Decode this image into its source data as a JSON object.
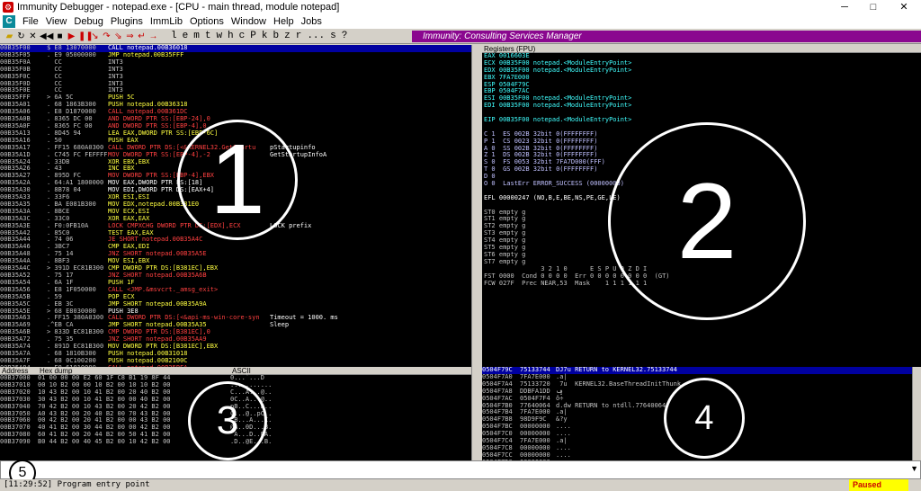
{
  "window": {
    "title": "Immunity Debugger - notepad.exe - [CPU - main thread, module notepad]",
    "minimize": "─",
    "maximize": "□",
    "close": "✕"
  },
  "menu": [
    "File",
    "View",
    "Debug",
    "Plugins",
    "ImmLib",
    "Options",
    "Window",
    "Help",
    "Jobs"
  ],
  "toolbar": {
    "letters": [
      "l",
      "e",
      "m",
      "t",
      "w",
      "h",
      "c",
      "P",
      "k",
      "b",
      "z",
      "r",
      "...",
      "s",
      "?"
    ],
    "consulting": "Immunity: Consulting Services Manager"
  },
  "cpu": {
    "rows": [
      {
        "a": "00B35F00",
        "h": "$ E8 13070000",
        "i": "CALL notepad.00B36018",
        "c": "c-red",
        "sel": true
      },
      {
        "a": "00B35F05",
        "h": ". E9 05000000",
        "i": "JMP notepad.00B35FFF",
        "c": "c-yellow"
      },
      {
        "a": "00B35F0A",
        "h": "  CC",
        "i": "INT3",
        "c": ""
      },
      {
        "a": "00B35F0B",
        "h": "  CC",
        "i": "INT3",
        "c": ""
      },
      {
        "a": "00B35F0C",
        "h": "  CC",
        "i": "INT3",
        "c": ""
      },
      {
        "a": "00B35F0D",
        "h": "  CC",
        "i": "INT3",
        "c": ""
      },
      {
        "a": "00B35F0E",
        "h": "  CC",
        "i": "INT3",
        "c": ""
      },
      {
        "a": "00B35FFF",
        "h": "> 6A 5C",
        "i": "PUSH 5C",
        "c": "c-yellow"
      },
      {
        "a": "00B35A01",
        "h": ". 68 1863B300",
        "i": "PUSH notepad.00B36318",
        "c": "c-yellow"
      },
      {
        "a": "00B35A06",
        "h": ". E8 D1870000",
        "i": "CALL notepad.00B361DC",
        "c": "c-red"
      },
      {
        "a": "00B35A0B",
        "h": ". 8365 DC 00",
        "i": "AND DWORD PTR SS:[EBP-24],0",
        "c": "c-red"
      },
      {
        "a": "00B35A0F",
        "h": ". 8365 FC 00",
        "i": "AND DWORD PTR SS:[EBP-4],0",
        "c": "c-red"
      },
      {
        "a": "00B35A13",
        "h": ". 8D45 94",
        "i": "LEA EAX,DWORD PTR SS:[EBP-6C]",
        "c": "c-yellow"
      },
      {
        "a": "00B35A16",
        "h": ". 50",
        "i": "PUSH EAX",
        "c": "c-yellow"
      },
      {
        "a": "00B35A17",
        "h": ". FF15 680A0300",
        "i": "CALL DWORD PTR DS:[<&KERNEL32.GetStartu",
        "c": "c-red"
      },
      {
        "a": "00B35A1D",
        "h": ". C745 FC FEFFFF",
        "i": "MOV DWORD PTR SS:[EBP-4],-2",
        "c": "c-red"
      },
      {
        "a": "00B35A24",
        "h": ". 33DB",
        "i": "XOR EBX,EBX",
        "c": "c-yellow"
      },
      {
        "a": "00B35A26",
        "h": ". 43",
        "i": "INC EBX",
        "c": "c-yellow"
      },
      {
        "a": "00B35A27",
        "h": ". 895D FC",
        "i": "MOV DWORD PTR SS:[EBP-4],EBX",
        "c": "c-red"
      },
      {
        "a": "00B35A2A",
        "h": ". 64:A1 1800000",
        "i": "MOV EAX,DWORD PTR FS:[18]",
        "c": "c-white"
      },
      {
        "a": "00B35A30",
        "h": ". 8B78 04",
        "i": "MOV EDI,DWORD PTR DS:[EAX+4]",
        "c": "c-white"
      },
      {
        "a": "00B35A33",
        "h": ". 33F6",
        "i": "XOR ESI,ESI",
        "c": "c-yellow"
      },
      {
        "a": "00B35A35",
        "h": ". BA E081B300",
        "i": "MOV EDX,notepad.00B381E0",
        "c": "c-yellow"
      },
      {
        "a": "00B35A3A",
        "h": ". 8BCE",
        "i": "MOV ECX,ESI",
        "c": "c-yellow"
      },
      {
        "a": "00B35A3C",
        "h": ". 33C0",
        "i": "XOR EAX,EAX",
        "c": "c-yellow"
      },
      {
        "a": "00B35A3E",
        "h": ". F0:0FB10A",
        "i": "LOCK CMPXCHG DWORD PTR DS:[EDX],ECX",
        "c": "c-red"
      },
      {
        "a": "00B35A42",
        "h": ". 85C0",
        "i": "TEST EAX,EAX",
        "c": "c-yellow"
      },
      {
        "a": "00B35A44",
        "h": ". 74 06",
        "i": "JE SHORT notepad.00B35A4C",
        "c": "c-red"
      },
      {
        "a": "00B35A46",
        "h": ". 3BC7",
        "i": "CMP EAX,EDI",
        "c": "c-yellow"
      },
      {
        "a": "00B35A48",
        "h": ". 75 14",
        "i": "JNZ SHORT notepad.00B35A5E",
        "c": "c-red"
      },
      {
        "a": "00B35A4A",
        "h": ". 8BF3",
        "i": "MOV ESI,EBX",
        "c": "c-yellow"
      },
      {
        "a": "00B35A4C",
        "h": "> 391D EC81B300",
        "i": "CMP DWORD PTR DS:[B381EC],EBX",
        "c": "c-yellow"
      },
      {
        "a": "00B35A52",
        "h": ". 75 17",
        "i": "JNZ SHORT notepad.00B35A6B",
        "c": "c-red"
      },
      {
        "a": "00B35A54",
        "h": ". 6A 1F",
        "i": "PUSH 1F",
        "c": "c-yellow"
      },
      {
        "a": "00B35A56",
        "h": ". E8 1F050000",
        "i": "CALL <JMP.&msvcrt._amsg_exit>",
        "c": "c-red"
      },
      {
        "a": "00B35A5B",
        "h": ". 59",
        "i": "POP ECX",
        "c": "c-yellow"
      },
      {
        "a": "00B35A5C",
        "h": ". EB 3C",
        "i": "JMP SHORT notepad.00B35A9A",
        "c": "c-yellow"
      },
      {
        "a": "00B35A5E",
        "h": "> 68 E8030000",
        "i": "PUSH 3E8",
        "c": "c-white"
      },
      {
        "a": "00B35A63",
        "h": ". FF15 380A0300",
        "i": "CALL DWORD PTR DS:[<&api-ms-win-core-syn",
        "c": "c-red"
      },
      {
        "a": "00B35A69",
        "h": ".^EB CA",
        "i": "JMP SHORT notepad.00B35A35",
        "c": "c-yellow"
      },
      {
        "a": "00B35A6B",
        "h": "> 833D EC81B300",
        "i": "CMP DWORD PTR DS:[B381EC],0",
        "c": "c-red"
      },
      {
        "a": "00B35A72",
        "h": ". 75 35",
        "i": "JNZ SHORT notepad.00B35AA9",
        "c": "c-red"
      },
      {
        "a": "00B35A74",
        "h": ". 891D EC81B300",
        "i": "MOV DWORD PTR DS:[B381EC],EBX",
        "c": "c-yellow"
      },
      {
        "a": "00B35A7A",
        "h": ". 68 1810B300",
        "i": "PUSH notepad.00B31018",
        "c": "c-yellow"
      },
      {
        "a": "00B35A7F",
        "h": ". 68 0C100200",
        "i": "PUSH notepad.00B2100C",
        "c": "c-yellow"
      },
      {
        "a": "00B35A84",
        "h": ". E8 61010000",
        "i": "CALL notepad.00B35BEA",
        "c": "c-red"
      },
      {
        "a": "00B35A89",
        "h": ". 59",
        "i": "POP ECX",
        "c": "c-yellow"
      },
      {
        "a": "00B35A8A",
        "h": ". 59",
        "i": "POP ECX",
        "c": "c-yellow"
      },
      {
        "a": "00B35A8B",
        "h": ". 85C0",
        "i": "TEST EAX,EAX",
        "c": "c-yellow"
      },
      {
        "a": "00B35A8D",
        "h": ". 74 08",
        "i": "JE SHORT notepad.00B35A9A",
        "c": "c-red"
      },
      {
        "a": "00B35A8F",
        "h": ". E9 3F010000",
        "i": "JMP notepad.00B35BD3",
        "c": "c-yellow"
      },
      {
        "a": "00B35A94",
        "h": ". 891D 8477B300",
        "i": "MOV DWORD PTR DS:[B37784],EBX",
        "c": "c-yellow"
      }
    ],
    "comments": [
      {
        "t": "pStartupinfo",
        "r": 14
      },
      {
        "t": "GetStartupInfoA",
        "r": 15
      },
      {
        "t": "LOCK prefix",
        "r": 25
      },
      {
        "t": "Timeout = 1000. ms",
        "r": 38
      },
      {
        "t": "Sleep",
        "r": 39
      }
    ]
  },
  "registers": {
    "header": "Registers (FPU)",
    "lines": [
      "EAX 0016603E",
      "ECX 00B35F00 notepad.<ModuleEntryPoint>",
      "EDX 00B35F00 notepad.<ModuleEntryPoint>",
      "EBX 7FA7E000",
      "ESP 0504F79C",
      "EBP 0504F7AC",
      "ESI 00B35F00 notepad.<ModuleEntryPoint>",
      "EDI 00B35F00 notepad.<ModuleEntryPoint>",
      "",
      "EIP 00B35F00 notepad.<ModuleEntryPoint>",
      "",
      "C 1  ES 002B 32bit 0(FFFFFFFF)",
      "P 1  CS 0023 32bit 0(FFFFFFFF)",
      "A 0  SS 002B 32bit 0(FFFFFFFF)",
      "Z 1  DS 002B 32bit 0(FFFFFFFF)",
      "S 0  FS 0053 32bit 7FA7D000(FFF)",
      "T 0  GS 002B 32bit 0(FFFFFFFF)",
      "D 0",
      "O 0  LastErr ERROR_SUCCESS (00000000)",
      "",
      "EFL 00000247 (NO,B,E,BE,NS,PE,GE,LE)",
      "",
      "ST0 empty g",
      "ST1 empty g",
      "ST2 empty g",
      "ST3 empty g",
      "ST4 empty g",
      "ST5 empty g",
      "ST6 empty g",
      "ST7 empty g",
      "               3 2 1 0      E S P U O Z D I",
      "FST 0000  Cond 0 0 0 0  Err 0 0 0 0 0 0 0 0  (GT)",
      "FCW 027F  Prec NEAR,53  Mask    1 1 1 1 1 1"
    ]
  },
  "dump": {
    "headers": [
      "Address",
      "Hex dump",
      "ASCII"
    ],
    "rows": [
      [
        "00B37000",
        "01 00 00 00 E2 60 1F C8 B1 19 8F 44",
        "0...`...D"
      ],
      [
        "00B37010",
        "00 10 B2 00 00 10 B2 00 10 10 B2 00",
        "..........."
      ],
      [
        "00B37020",
        "10 43 B2 00 10 41 B2 00 20 40 B2 00",
        "C...A...@.."
      ],
      [
        "00B37030",
        "30 43 B2 00 10 41 B2 00 00 40 B2 00",
        "0C..A...@.."
      ],
      [
        "00B37040",
        "70 42 B2 00 10 43 B2 00 20 42 B2 00",
        "pB..C...B.."
      ],
      [
        "00B37050",
        "A0 43 B2 00 20 40 B2 00 70 43 B2 00",
        "C...@..pC.."
      ],
      [
        "00B37060",
        "00 42 B2 00 20 41 B2 00 00 43 B2 00",
        ".B...A...C."
      ],
      [
        "00B37070",
        "40 41 B2 00 30 44 B2 00 00 42 B2 00",
        "@A..0D...B."
      ],
      [
        "00B37080",
        "60 41 B2 00 20 44 B2 00 50 41 B2 00",
        "`A...D..PA."
      ],
      [
        "00B37090",
        "B0 44 B2 00 40 45 B2 00 10 42 B2 00",
        ".D..@E...B."
      ]
    ]
  },
  "stack": {
    "rows": [
      {
        "a": "0504F79C",
        "v": "75133744",
        "c": "DJ7u RETURN to KERNEL32.75133744",
        "sel": true
      },
      {
        "a": "0504F7A0",
        "v": "7FA7E000",
        "c": ".a|"
      },
      {
        "a": "0504F7A4",
        "v": "75133720",
        "c": " 7u  KERNEL32.BaseThreadInitThunk"
      },
      {
        "a": "0504F7A8",
        "v": "DDBFA1DD",
        "c": "ݡ"
      },
      {
        "a": "0504F7AC",
        "v": "0504F7F4",
        "c": "ô÷"
      },
      {
        "a": "0504F7B0",
        "v": "77640064",
        "c": "d.dw RETURN to ntdll.77640064"
      },
      {
        "a": "0504F7B4",
        "v": "7FA7E000",
        "c": ".a|"
      },
      {
        "a": "0504F7B8",
        "v": "98D9F9C",
        "c": "&?y"
      },
      {
        "a": "0504F7BC",
        "v": "00000000",
        "c": "...."
      },
      {
        "a": "0504F7C0",
        "v": "00000000",
        "c": "...."
      },
      {
        "a": "0504F7C4",
        "v": "7FA7E000",
        "c": ".a|"
      },
      {
        "a": "0504F7C8",
        "v": "00000000",
        "c": "...."
      },
      {
        "a": "0504F7CC",
        "v": "00000000",
        "c": "...."
      },
      {
        "a": "0504F7D0",
        "v": "00000000",
        "c": "...."
      }
    ]
  },
  "annotations": [
    "1",
    "2",
    "3",
    "4",
    "5"
  ],
  "status": {
    "message": "[11:29:52] Program entry point",
    "state": "Paused"
  },
  "colors": {
    "consult_bg": "#8a078f",
    "paused_bg": "#ffff00",
    "paused_fg": "#cc0000",
    "selection": "#0000a0"
  }
}
